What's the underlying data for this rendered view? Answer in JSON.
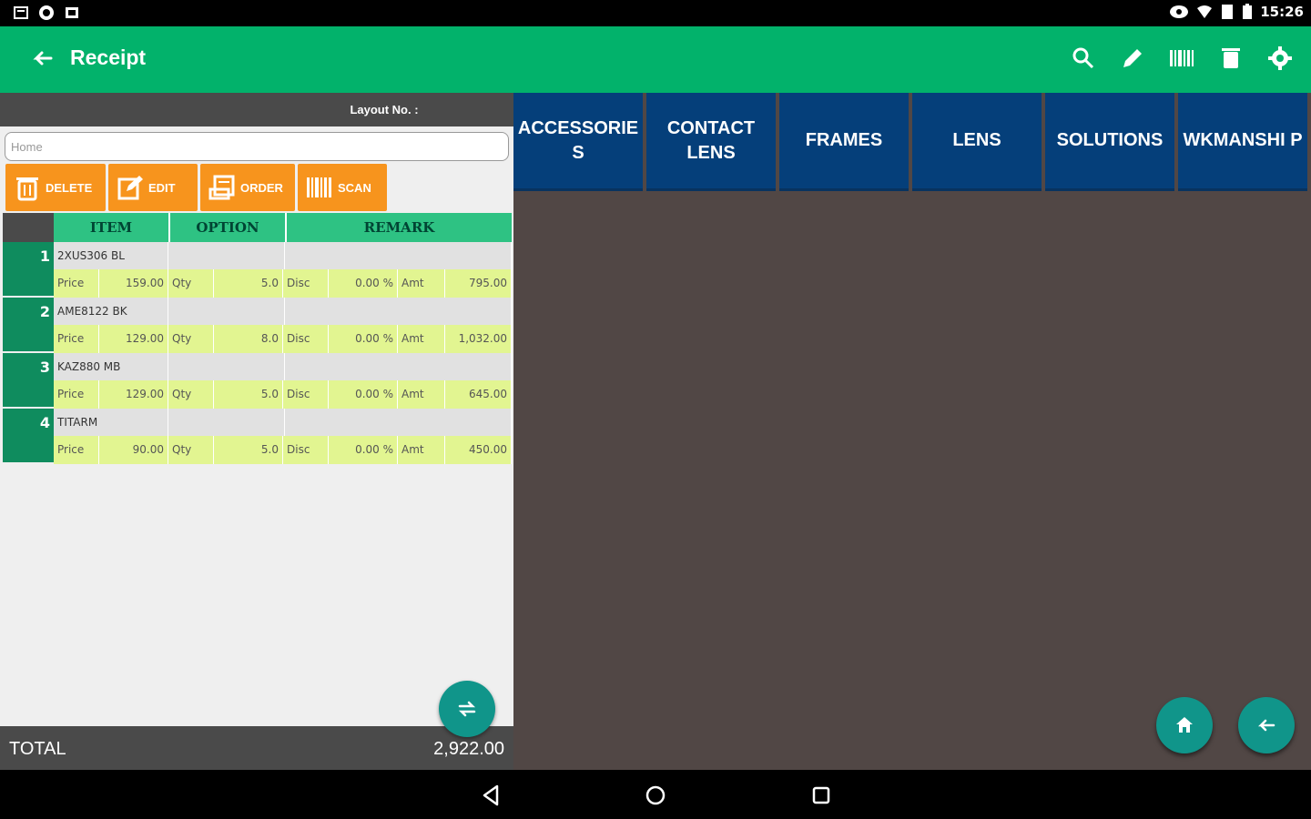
{
  "status": {
    "time": "15:26"
  },
  "app": {
    "title": "Receipt"
  },
  "layout": {
    "label": "Layout No. :"
  },
  "search": {
    "placeholder": "Home"
  },
  "buttons": {
    "delete": "DELETE",
    "edit": "EDIT",
    "order": "ORDER",
    "scan": "SCAN"
  },
  "grid": {
    "headers": {
      "item": "ITEM",
      "option": "OPTION",
      "remark": "REMARK"
    },
    "labels": {
      "price": "Price",
      "qty": "Qty",
      "disc": "Disc",
      "amt": "Amt"
    },
    "rows": [
      {
        "num": "1",
        "item": "2XUS306 BL",
        "price": "159.00",
        "qty": "5.0",
        "disc": "0.00 %",
        "amt": "795.00"
      },
      {
        "num": "2",
        "item": "AME8122 BK",
        "price": "129.00",
        "qty": "8.0",
        "disc": "0.00 %",
        "amt": "1,032.00"
      },
      {
        "num": "3",
        "item": "KAZ880 MB",
        "price": "129.00",
        "qty": "5.0",
        "disc": "0.00 %",
        "amt": "645.00"
      },
      {
        "num": "4",
        "item": "TITARM",
        "price": "90.00",
        "qty": "5.0",
        "disc": "0.00 %",
        "amt": "450.00"
      }
    ]
  },
  "total": {
    "label": "TOTAL",
    "value": "2,922.00"
  },
  "categories": {
    "c0": "ACCESSORIE S",
    "c1": "CONTACT LENS",
    "c2": "FRAMES",
    "c3": "LENS",
    "c4": "SOLUTIONS",
    "c5": "WKMANSHI P"
  },
  "icons": {
    "back": "arrow-left-icon",
    "search": "search-icon",
    "edit": "pencil-icon",
    "barcode": "barcode-icon",
    "trash": "trash-icon",
    "settings": "gear-icon",
    "swap": "swap-icon",
    "home": "home-icon",
    "nav_back": "triangle-back-icon",
    "nav_home": "circle-home-icon",
    "nav_recent": "square-recent-icon"
  },
  "colors": {
    "primary": "#02b26b",
    "accent": "#f7941d",
    "category": "#053f7a",
    "fab": "#10958a"
  }
}
